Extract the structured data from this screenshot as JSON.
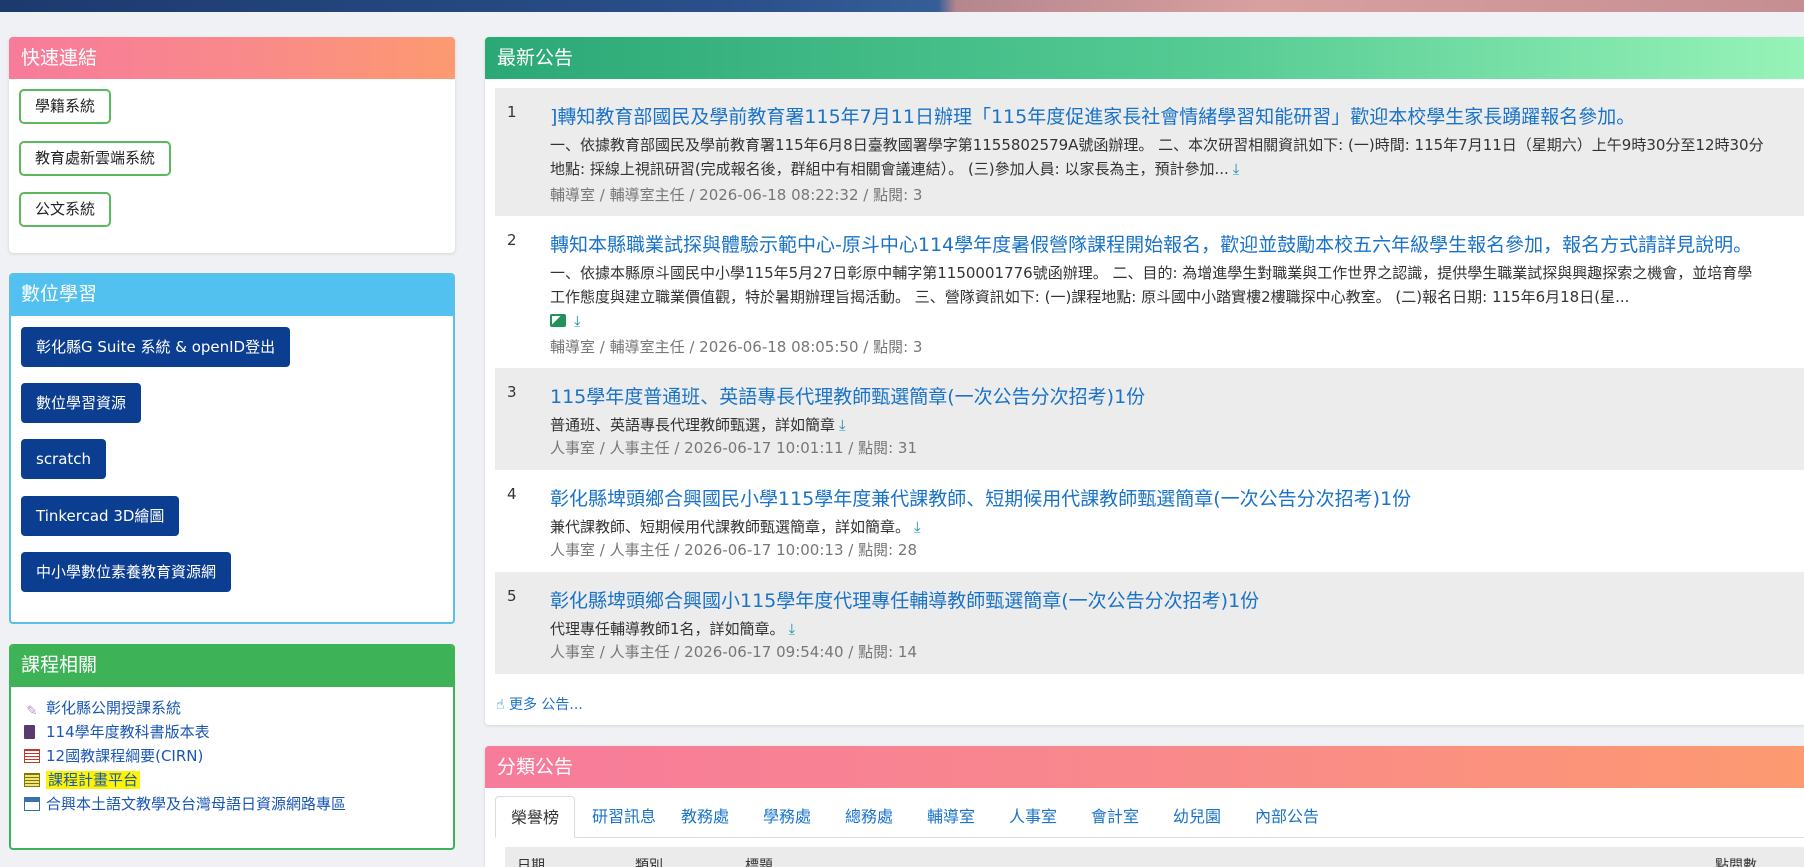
{
  "quick_links": {
    "title": "快速連結",
    "buttons": [
      "學籍系統",
      "教育處新雲端系統",
      "公文系統"
    ]
  },
  "digital_learning": {
    "title": "數位學習",
    "buttons": [
      "彰化縣G Suite 系統 & openID登出",
      "數位學習資源",
      "scratch",
      "Tinkercad 3D繪圖",
      "中小學數位素養教育資源網"
    ]
  },
  "courses": {
    "title": "課程相關",
    "links": [
      "彰化縣公開授課系統",
      "114學年度教科書版本表",
      "12國教課程綱要(CIRN)",
      "課程計畫平台",
      "合興本土語文教學及台灣母語日資源網路專區"
    ],
    "icons": [
      "pencil-icon",
      "book-icon",
      "grid-icon",
      "table-icon",
      "calendar-icon"
    ]
  },
  "news": {
    "title": "最新公告",
    "items": [
      {
        "num": "1",
        "title": "]轉知教育部國民及學前教育署115年7月11日辦理「115年度促進家長社會情緒學習知能研習」歡迎本校學生家長踴躍報名參加。",
        "desc1": "一、依據教育部國民及學前教育署115年6月8日臺教國署學字第1155802579A號函辦理。 二、本次研習相關資訊如下: (一)時間: 115年7月11日（星期六）上午9時30分至12時30分",
        "desc2": "地點: 採線上視訊研習(完成報名後，群組中有相關會議連結）。 (三)參加人員: 以家長為主，預計參加...",
        "meta": "輔導室 / 輔導室主任 / 2026-06-18 08:22:32 / 點閱: 3"
      },
      {
        "num": "2",
        "title": "轉知本縣職業試探與體驗示範中心-原斗中心114學年度暑假營隊課程開始報名，歡迎並鼓勵本校五六年級學生報名參加，報名方式請詳見說明。",
        "desc1": "一、依據本縣原斗國民中小學115年5月27日彰原中輔字第1150001776號函辦理。 二、目的: 為增進學生對職業與工作世界之認識，提供學生職業試探與興趣探索之機會，並培育學",
        "desc2": "工作態度與建立職業價值觀，特於暑期辦理旨揭活動。 三、營隊資訊如下: (一)課程地點: 原斗國中小踏實樓2樓職探中心教室。 (二)報名日期: 115年6月18日(星...",
        "meta": "輔導室 / 輔導室主任 / 2026-06-18 08:05:50 / 點閱: 3"
      },
      {
        "num": "3",
        "title": "115學年度普通班、英語專長代理教師甄選簡章(一次公告分次招考)1份",
        "desc1": "普通班、英語專長代理教師甄選，詳如簡章",
        "meta": "人事室 / 人事主任 / 2026-06-17 10:01:11 / 點閱: 31"
      },
      {
        "num": "4",
        "title": "彰化縣埤頭鄉合興國民小學115學年度兼代課教師、短期候用代課教師甄選簡章(一次公告分次招考)1份",
        "desc1": "兼代課教師、短期候用代課教師甄選簡章，詳如簡章。",
        "meta": "人事室 / 人事主任 / 2026-06-17 10:00:13 / 點閱: 28"
      },
      {
        "num": "5",
        "title": "彰化縣埤頭鄉合興國小115學年度代理專任輔導教師甄選簡章(一次公告分次招考)1份",
        "desc1": "代理專任輔導教師1名，詳如簡章。",
        "meta": "人事室 / 人事主任 / 2026-06-17 09:54:40 / 點閱: 14"
      }
    ],
    "more": "更多 公告..."
  },
  "category": {
    "title": "分類公告",
    "tabs": [
      "榮譽榜",
      "研習訊息",
      "教務處",
      "學務處",
      "總務處",
      "輔導室",
      "人事室",
      "會計室",
      "幼兒園",
      "內部公告"
    ],
    "columns": [
      "日期",
      "類別",
      "標題",
      "點閱數"
    ]
  },
  "colors": {
    "link": "#1a73c9",
    "highlight": "#fff400",
    "digital_button": "#0b3d91",
    "quick_border": "#5cb85c"
  }
}
